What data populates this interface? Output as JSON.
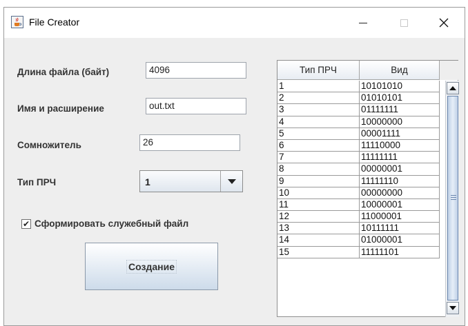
{
  "window": {
    "title": "File Creator",
    "controls": {
      "minimize": "—",
      "maximize": "□",
      "close": "✕"
    }
  },
  "form": {
    "file_length_label": "Длина файла (байт)",
    "file_length_value": "4096",
    "name_ext_label": "Имя и расширение",
    "name_ext_value": "out.txt",
    "multiplier_label": "Сомножитель",
    "multiplier_value": "26",
    "prng_type_label": "Тип ПРЧ",
    "prng_type_selected": "1",
    "service_file_checkbox_label": "Сформировать служебный файл",
    "service_file_checked": true,
    "create_button_label": "Создание"
  },
  "table": {
    "headers": [
      "Тип ПРЧ",
      "Вид"
    ],
    "rows": [
      [
        "1",
        "10101010"
      ],
      [
        "2",
        "01010101"
      ],
      [
        "3",
        "01111111"
      ],
      [
        "4",
        "10000000"
      ],
      [
        "5",
        "00001111"
      ],
      [
        "6",
        "11110000"
      ],
      [
        "7",
        "11111111"
      ],
      [
        "8",
        "00000001"
      ],
      [
        "9",
        "11111110"
      ],
      [
        "10",
        "00000000"
      ],
      [
        "11",
        "10000001"
      ],
      [
        "12",
        "11000001"
      ],
      [
        "13",
        "10111111"
      ],
      [
        "14",
        "01000001"
      ],
      [
        "15",
        "11111101"
      ]
    ]
  },
  "icons": {
    "app": "java-cup-icon",
    "checkmark": "checkmark-icon",
    "combo_arrow": "chevron-down-icon",
    "scroll_up": "scroll-up-arrow-icon",
    "scroll_down": "scroll-down-arrow-icon"
  }
}
